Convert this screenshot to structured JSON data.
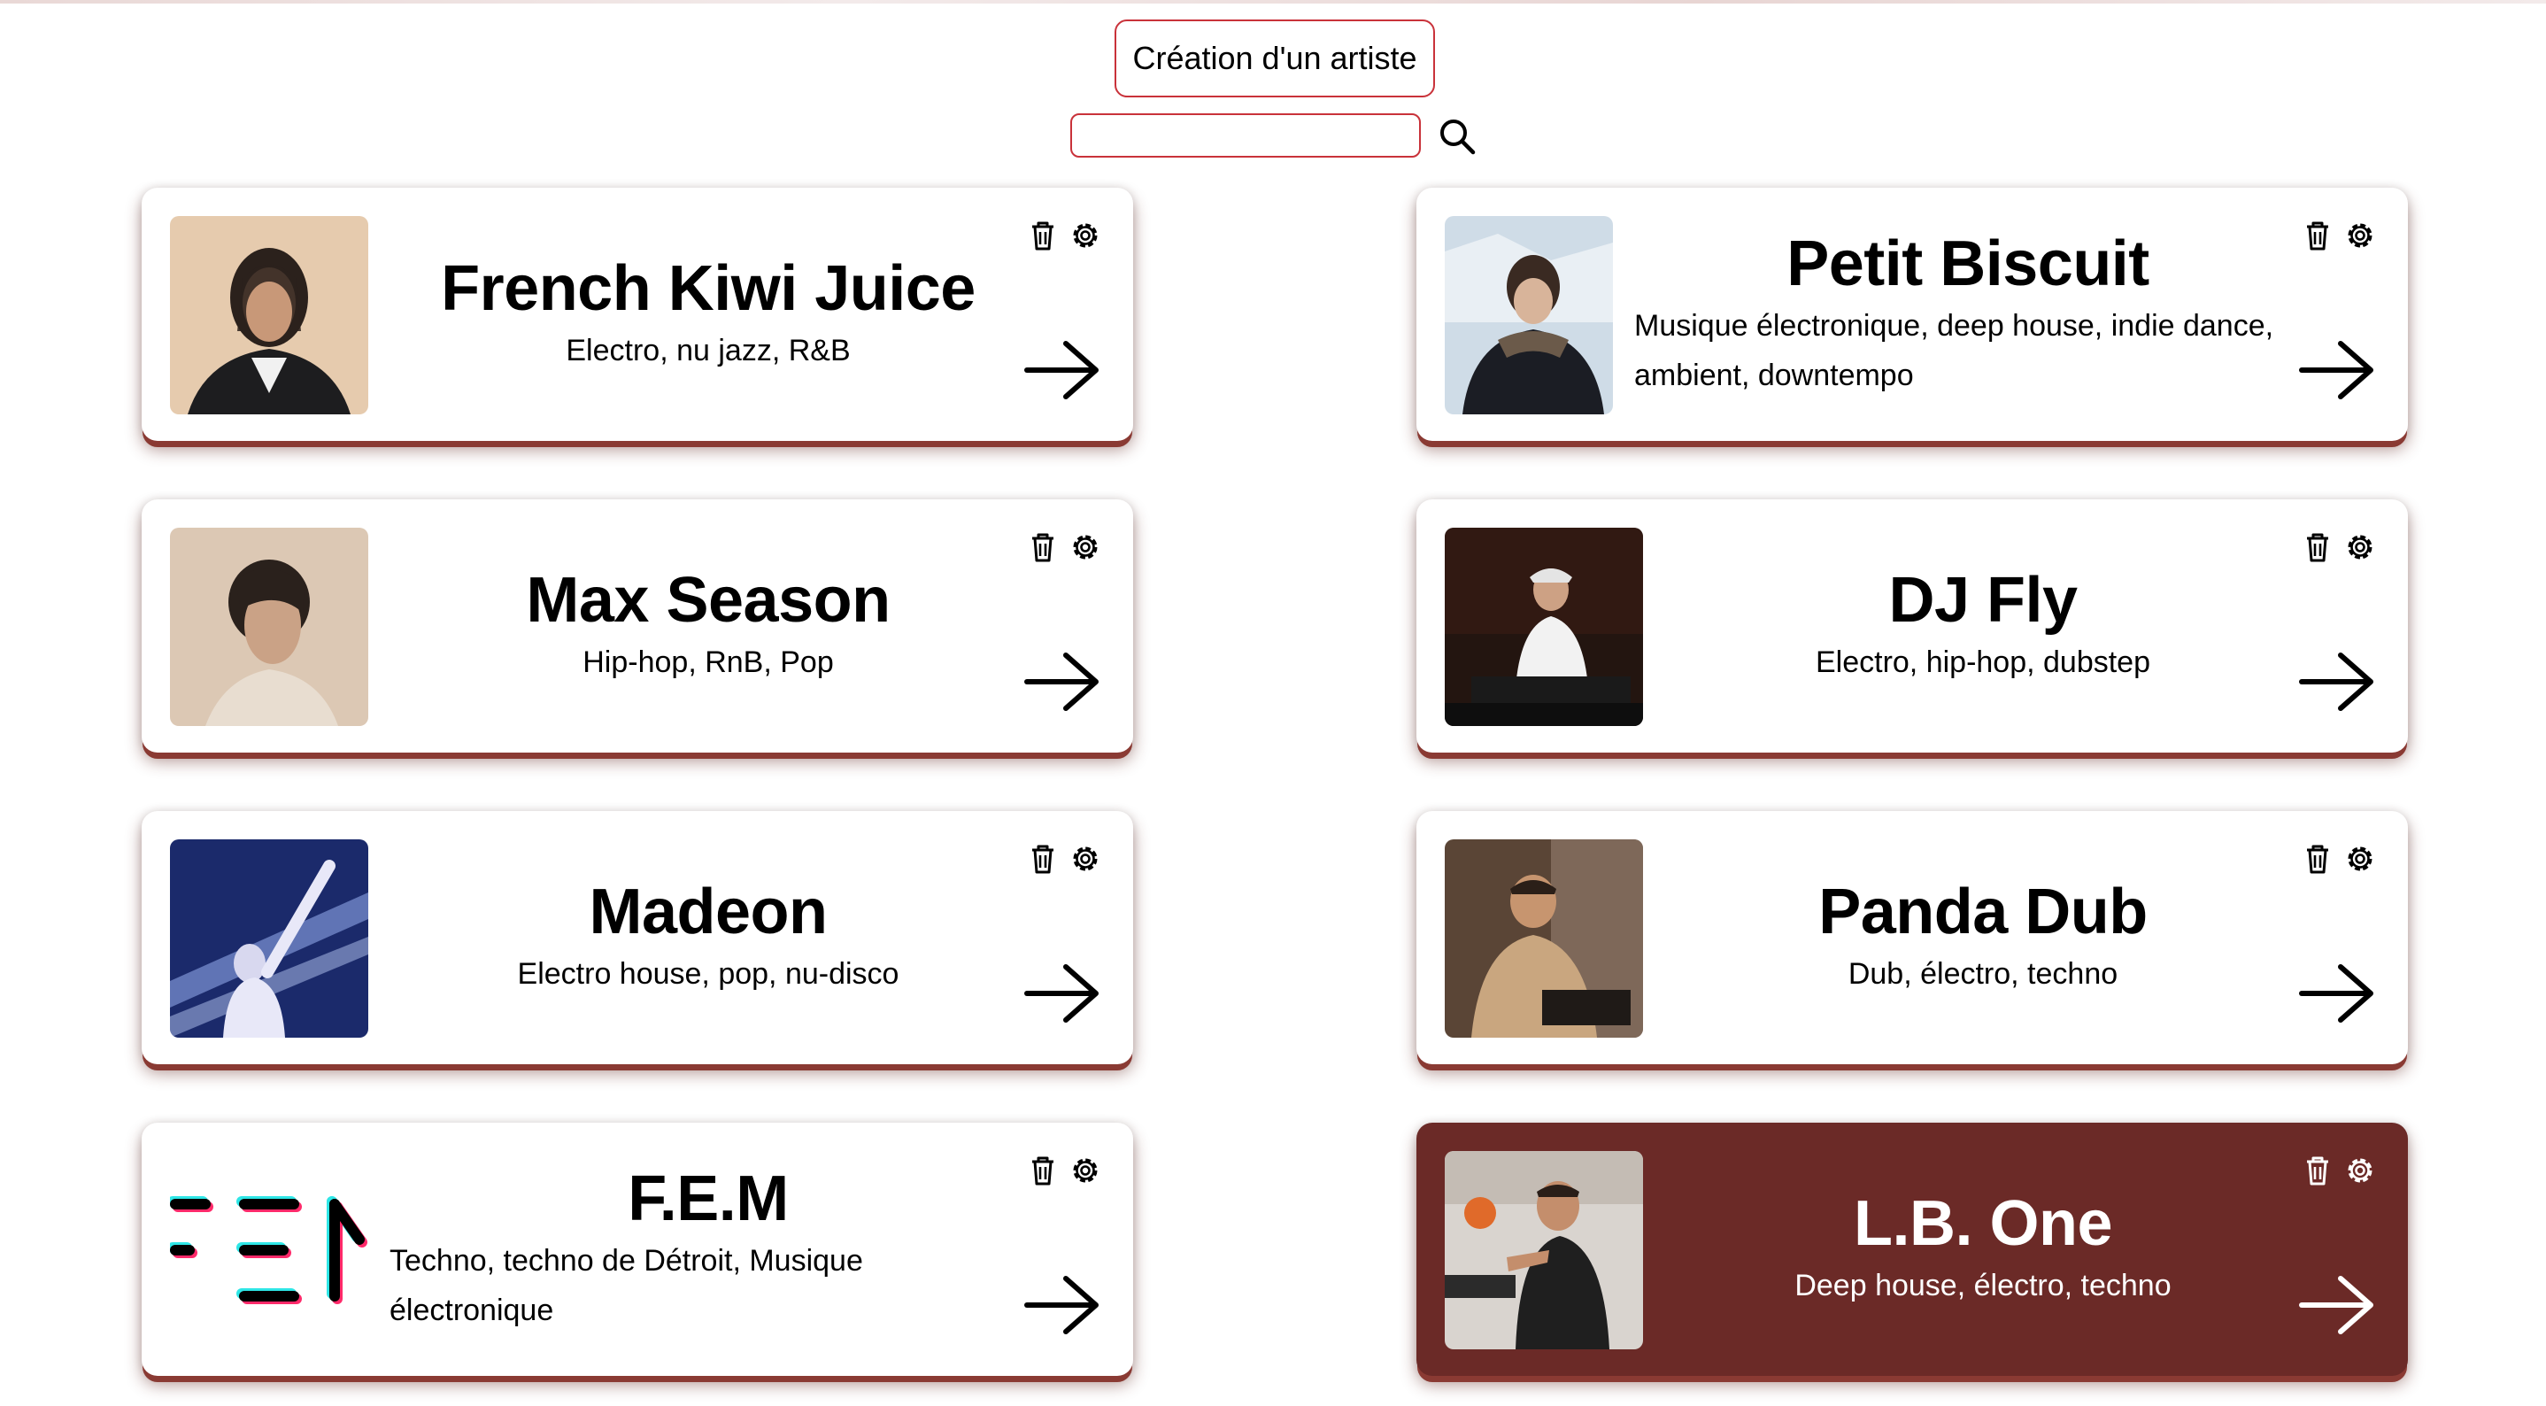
{
  "header": {
    "create_label": "Création d'un artiste",
    "search_placeholder": "",
    "search_value": ""
  },
  "icons": {
    "delete": "trash-icon",
    "settings": "gear-icon",
    "open": "arrow-right-icon",
    "search": "search-icon"
  },
  "colors": {
    "accent_border": "#c9323a",
    "active_card_bg": "#6b2a27",
    "card_shadow": "#8a3a33"
  },
  "artists": [
    {
      "name": "French Kiwi Juice",
      "genres": "Electro, nu jazz, R&B"
    },
    {
      "name": "Petit Biscuit",
      "genres": "Musique électronique, deep house, indie dance, ambient, downtempo"
    },
    {
      "name": "Max Season",
      "genres": "Hip-hop, RnB, Pop"
    },
    {
      "name": "DJ Fly",
      "genres": "Electro, hip-hop, dubstep"
    },
    {
      "name": "Madeon",
      "genres": "Electro house, pop, nu-disco"
    },
    {
      "name": "Panda Dub",
      "genres": "Dub, électro, techno"
    },
    {
      "name": "F.E.M",
      "genres": "Techno, techno de Détroit, Musique électronique",
      "logo_text": "FEM"
    },
    {
      "name": "L.B. One",
      "genres": "Deep house, électro, techno",
      "active": true
    }
  ]
}
